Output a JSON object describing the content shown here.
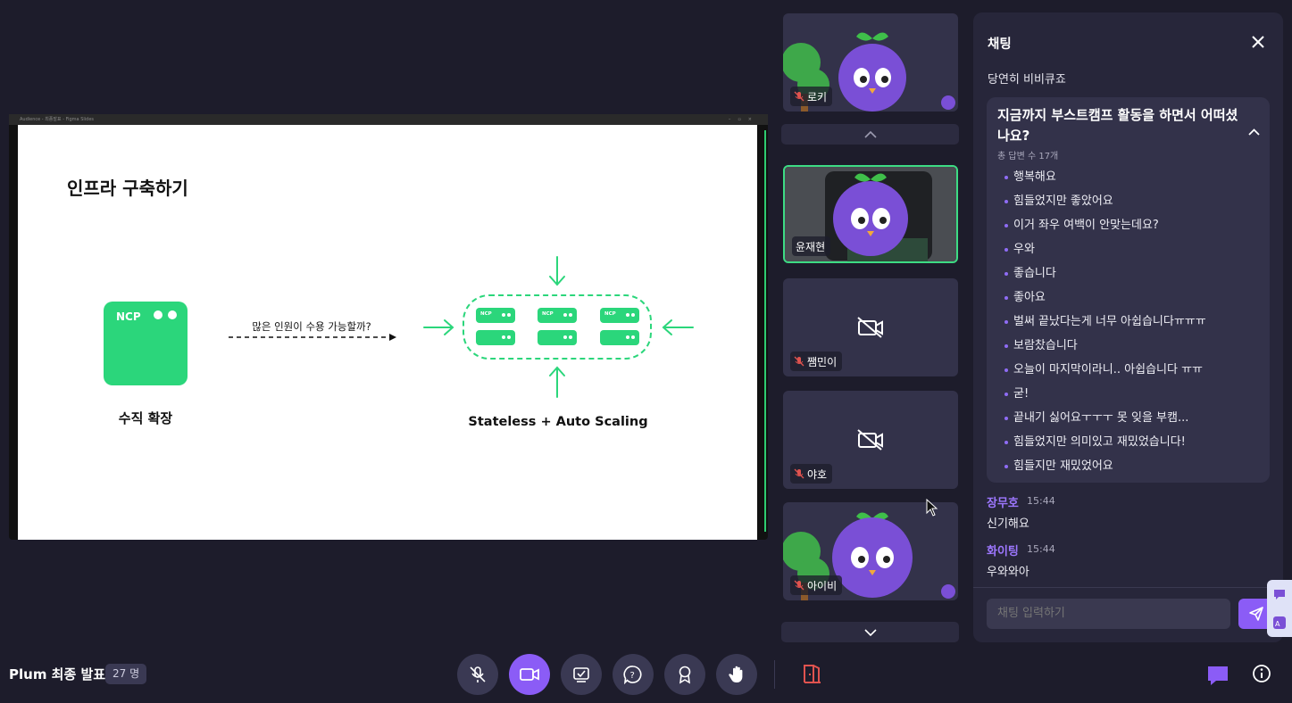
{
  "slide": {
    "window_title": "Audience - 최종발표 - Figma Slides",
    "title": "인프라 구축하기",
    "ncp_label": "NCP",
    "left_caption": "수직 확장",
    "arrow_caption": "많은 인원이 수용 가능할까?",
    "server_label": "NCP",
    "right_caption": "Stateless + Auto Scaling"
  },
  "participants": [
    {
      "name": "로키",
      "video": "avatar",
      "muted": true
    },
    {
      "name": "윤재현",
      "video": "avatar",
      "muted": false,
      "active": true
    },
    {
      "name": "쨈민이",
      "video": "off",
      "muted": true
    },
    {
      "name": "야호",
      "video": "off",
      "muted": true
    },
    {
      "name": "아이비",
      "video": "avatar",
      "muted": true
    }
  ],
  "chat": {
    "title": "채팅",
    "previous_message": "당연히 비비큐죠",
    "question": {
      "title": "지금까지 부스트캠프 활동을 하면서 어떠셨나요?",
      "count_label": "총 답변 수 17개",
      "answers": [
        "행복해요",
        "힘들었지만 좋았어요",
        "이거 좌우 여백이 안맞는데요?",
        "우와",
        "좋습니다",
        "좋아요",
        "벌써 끝났다는게 너무 아쉽습니다ㅠㅠㅠ",
        "보람찼습니다",
        "오늘이 마지막이라니.. 아쉽습니다 ㅠㅠ",
        "굳!",
        "끝내기 싫어요ㅜㅜㅜ 못 잊을 부캠...",
        "힘들었지만 의미있고 재밌었습니다!",
        "힘들지만 재밌었어요"
      ]
    },
    "messages": [
      {
        "author": "장무호",
        "time": "15:44",
        "text": "신기해요"
      },
      {
        "author": "화이팅",
        "time": "15:44",
        "text": "우와와아"
      }
    ],
    "input_placeholder": "채팅 입력하기"
  },
  "room": {
    "title": "Plum 최종 발표",
    "participant_count": "27 명"
  },
  "controls": [
    "mic-off-icon",
    "camera-icon",
    "screen-share-icon",
    "question-icon",
    "badge-icon",
    "raise-hand-icon"
  ],
  "colors": {
    "background": "#1d1c2b",
    "accent": "#8b5cf6",
    "slide_green": "#2bd67b",
    "active_border": "#3ddc84",
    "exit_red": "#e0534f"
  }
}
